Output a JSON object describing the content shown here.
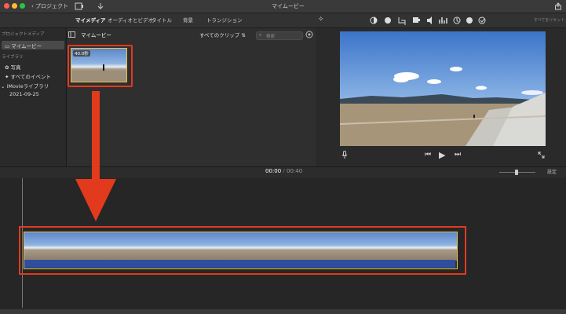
{
  "titlebar": {
    "back_label": "プロジェクト",
    "window_title": "マイムービー",
    "traffic_colors": [
      "#fe5f57",
      "#febc2e",
      "#28c840"
    ]
  },
  "toolbar": {
    "tabs": [
      {
        "label": "マイメディア",
        "active": true
      },
      {
        "label": "オーディオとビデオ",
        "active": false
      },
      {
        "label": "タイトル",
        "active": false
      },
      {
        "label": "背景",
        "active": false
      },
      {
        "label": "トランジション",
        "active": false
      }
    ],
    "reset_all": "すべてをリセット"
  },
  "sidebar": {
    "project_media_header": "プロジェクトメディア",
    "project_item": "マイムービー",
    "library_header": "ライブラリ",
    "photos": "写真",
    "all_events": "すべてのイベント",
    "library_name": "iMovieライブラリ",
    "event_date": "2021-09-25"
  },
  "browser": {
    "title": "マイムービー",
    "filter_label": "すべてのクリップ",
    "search_placeholder": "検索",
    "clip_duration": "40.0秒"
  },
  "timeline": {
    "current_time": "00:00",
    "separator": "/",
    "total_time": "00:40",
    "settings_label": "設定"
  },
  "icons": {
    "back": "chevron-left-icon",
    "media": "film-icon",
    "import": "download-arrow-icon",
    "share": "share-icon",
    "magic": "magic-wand-icon",
    "mic": "microphone-icon",
    "fullscreen": "fullscreen-icon"
  },
  "colors": {
    "accent_red": "#e23a1c",
    "clip_border": "#e8c14b",
    "audio_track": "#2f4f9e"
  }
}
